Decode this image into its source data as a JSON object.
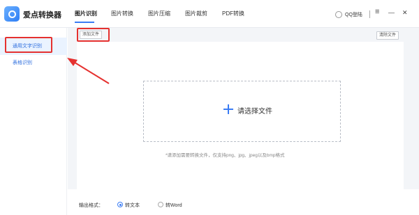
{
  "app": {
    "title": "爱点转换器"
  },
  "nav": {
    "tabs": [
      {
        "label": "图片识别"
      },
      {
        "label": "图片转换"
      },
      {
        "label": "图片压缩"
      },
      {
        "label": "图片裁剪"
      },
      {
        "label": "PDF转换"
      }
    ],
    "active_index": 0
  },
  "account": {
    "label": "QQ登陆"
  },
  "window": {
    "menu": "≡",
    "minimize": "—",
    "close": "✕"
  },
  "sidebar": {
    "items": [
      {
        "label": "通用文字识别"
      },
      {
        "label": "表格识别"
      }
    ],
    "active_index": 0
  },
  "toolbar": {
    "add_file": "添加文件",
    "clear_file": "清除文件"
  },
  "drop_zone": {
    "choose_label": "请选择文件",
    "hint": "*请添加需要转换文件，仅支持png、jpg、jpeg以及bmp格式"
  },
  "output": {
    "label": "输出格式：",
    "options": [
      {
        "label": "转文本",
        "checked": true
      },
      {
        "label": "转Word",
        "checked": false
      }
    ]
  },
  "colors": {
    "accent": "#3a7cf4",
    "highlight": "#e5312f"
  }
}
